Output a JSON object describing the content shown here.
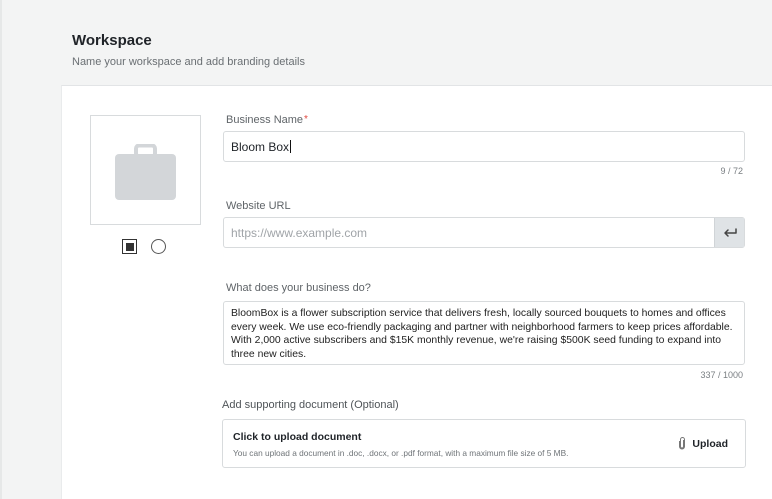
{
  "header": {
    "title": "Workspace",
    "subtitle": "Name your workspace and add branding details"
  },
  "logo": {
    "icon": "briefcase-icon",
    "shape_options": [
      "square",
      "circle"
    ],
    "selected_shape": "square"
  },
  "business_name": {
    "label": "Business Name",
    "required_mark": "*",
    "value": "Bloom Box",
    "counter": "9 / 72"
  },
  "website": {
    "label": "Website URL",
    "placeholder": "https://www.example.com",
    "submit_icon": "enter-arrow-icon"
  },
  "description": {
    "label": "What does your business do?",
    "value": "BloomBox is a flower subscription service that delivers fresh, locally sourced bouquets to homes and offices every week. We use eco-friendly packaging and partner with neighborhood farmers to keep prices affordable. With 2,000 active subscribers and $15K monthly revenue, we're raising $500K seed funding to expand into three new cities.",
    "counter": "337 / 1000"
  },
  "upload": {
    "section_label": "Add supporting document (Optional)",
    "title": "Click to upload document",
    "hint": "You can upload a document in .doc, .docx, or .pdf format, with a maximum file size of 5 MB.",
    "button_label": "Upload",
    "button_icon": "paperclip-icon"
  },
  "colors": {
    "page_bg": "#f3f4f4",
    "card_bg": "#ffffff",
    "required": "#e0473f",
    "icon_gray": "#d3d6d9"
  }
}
